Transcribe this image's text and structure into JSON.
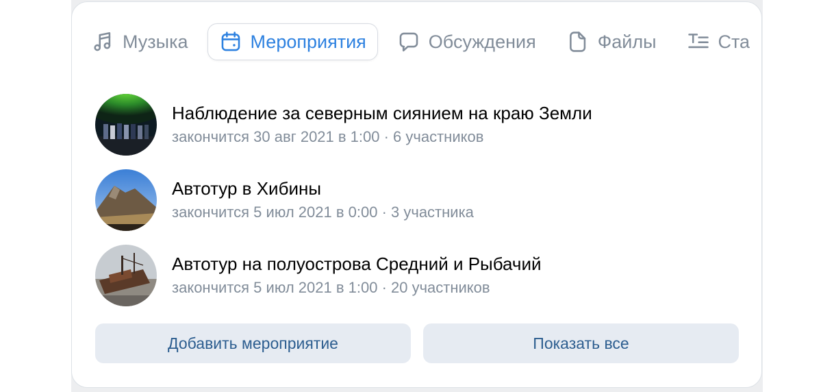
{
  "tabs": [
    {
      "label": "Музыка",
      "icon": "music-note-icon",
      "active": false
    },
    {
      "label": "Мероприятия",
      "icon": "calendar-icon",
      "active": true
    },
    {
      "label": "Обсуждения",
      "icon": "speech-bubble-icon",
      "active": false
    },
    {
      "label": "Файлы",
      "icon": "document-icon",
      "active": false
    },
    {
      "label": "Ста",
      "icon": "text-lines-icon",
      "active": false
    }
  ],
  "events": [
    {
      "title": "Наблюдение за северным сиянием на краю Земли",
      "subtitle": "закончится 30 авг 2021 в 1:00 · 6 участников"
    },
    {
      "title": "Автотур в Хибины",
      "subtitle": "закончится 5 июл 2021 в 0:00 · 3 участника"
    },
    {
      "title": "Автотур на полуострова Средний и Рыбачий",
      "subtitle": "закончится 5 июл 2021 в 1:00 · 20 участников"
    }
  ],
  "buttons": {
    "add_event": "Добавить мероприятие",
    "show_all": "Показать все"
  },
  "colors": {
    "accent": "#2d81e0",
    "muted": "#818c99",
    "button_bg": "#e6ebf2",
    "button_text": "#2c5d8f"
  }
}
